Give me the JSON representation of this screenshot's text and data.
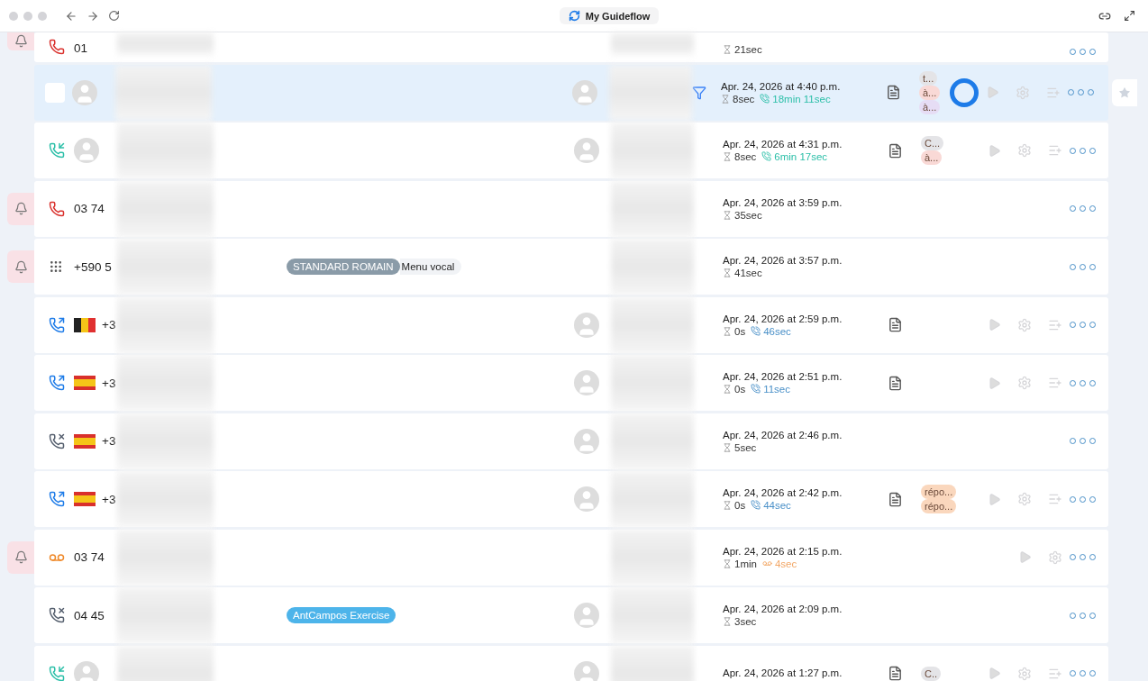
{
  "window": {
    "title": "My Guideflow"
  },
  "rows": [
    {
      "cut_top": true,
      "selected": false,
      "alert": true,
      "call": {
        "kind": "missed"
      },
      "number": "01",
      "wait": "21sec"
    },
    {
      "selected": true,
      "checked": false,
      "alert": false,
      "contact": true,
      "contact2": true,
      "filter": true,
      "date": "Apr. 24, 2026 at 4:40 p.m.",
      "wait": "8sec",
      "talk": {
        "kind": "call",
        "text": "18min 11sec",
        "color": "#2bbfa8"
      },
      "note": true,
      "tags": [
        {
          "label": "t...",
          "color": "#e4e4e7"
        },
        {
          "label": "à...",
          "color": "#f9d9d6"
        },
        {
          "label": "à...",
          "color": "#e6ddf5"
        }
      ],
      "actions": [
        {
          "kind": "play"
        },
        {
          "kind": "gear"
        },
        {
          "kind": "add"
        }
      ],
      "click_highlight": true,
      "starred": false
    },
    {
      "selected": false,
      "alert": false,
      "call": {
        "kind": "incoming"
      },
      "contact": true,
      "contact2": true,
      "date": "Apr. 24, 2026 at 4:31 p.m.",
      "wait": "8sec",
      "talk": {
        "kind": "call",
        "text": "6min 17sec",
        "color": "#2bbfa8"
      },
      "note": true,
      "tags": [
        {
          "label": "C...",
          "color": "#e4e4e7"
        },
        {
          "label": "à...",
          "color": "#f9d9d6"
        }
      ],
      "actions": [
        {
          "kind": "play"
        },
        {
          "kind": "gear"
        },
        {
          "kind": "add"
        }
      ]
    },
    {
      "selected": false,
      "alert": true,
      "call": {
        "kind": "missed"
      },
      "number": "03 74",
      "date": "Apr. 24, 2026 at 3:59 p.m.",
      "wait": "35sec"
    },
    {
      "selected": false,
      "alert": true,
      "call": {
        "kind": "keypad"
      },
      "number": "+590 5",
      "ivr": {
        "label": "STANDARD ROMAIN",
        "menu": "Menu vocal"
      },
      "date": "Apr. 24, 2026 at 3:57 p.m.",
      "wait": "41sec"
    },
    {
      "selected": false,
      "alert": false,
      "call": {
        "kind": "outgoing"
      },
      "flag": {
        "kind": "be"
      },
      "number": "+3",
      "contact2": true,
      "date": "Apr. 24, 2026 at 2:59 p.m.",
      "wait": "0s",
      "talk": {
        "kind": "call",
        "text": "46sec",
        "color": "#4a90c8"
      },
      "note": true,
      "actions": [
        {
          "kind": "play"
        },
        {
          "kind": "gear"
        },
        {
          "kind": "add"
        }
      ]
    },
    {
      "selected": false,
      "alert": false,
      "call": {
        "kind": "outgoing"
      },
      "flag": {
        "kind": "es"
      },
      "number": "+3",
      "contact2": true,
      "date": "Apr. 24, 2026 at 2:51 p.m.",
      "wait": "0s",
      "talk": {
        "kind": "call",
        "text": "11sec",
        "color": "#4a90c8"
      },
      "note": true,
      "actions": [
        {
          "kind": "play"
        },
        {
          "kind": "gear"
        },
        {
          "kind": "add"
        }
      ]
    },
    {
      "selected": false,
      "alert": false,
      "call": {
        "kind": "cancelled"
      },
      "flag": {
        "kind": "es"
      },
      "number": "+3",
      "contact2": true,
      "date": "Apr. 24, 2026 at 2:46 p.m.",
      "wait": "5sec"
    },
    {
      "selected": false,
      "alert": false,
      "call": {
        "kind": "outgoing"
      },
      "flag": {
        "kind": "es"
      },
      "number": "+3",
      "contact2": true,
      "date": "Apr. 24, 2026 at 2:42 p.m.",
      "wait": "0s",
      "talk": {
        "kind": "call",
        "text": "44sec",
        "color": "#4a90c8"
      },
      "note": true,
      "tags": [
        {
          "label": "répo...",
          "color": "#fad7bd"
        },
        {
          "label": "répo...",
          "color": "#fad7bd"
        }
      ],
      "actions": [
        {
          "kind": "play"
        },
        {
          "kind": "gear"
        },
        {
          "kind": "add"
        }
      ]
    },
    {
      "selected": false,
      "alert": true,
      "call": {
        "kind": "voicemail"
      },
      "number": "03 74",
      "date": "Apr. 24, 2026 at 2:15 p.m.",
      "wait": "1min",
      "talk": {
        "kind": "voicemail",
        "text": "4sec",
        "color": "#f2a766"
      },
      "actions": [
        {
          "kind": "play"
        },
        {
          "kind": "gear"
        }
      ]
    },
    {
      "selected": false,
      "alert": false,
      "call": {
        "kind": "cancelled"
      },
      "number": "04 45",
      "team": "AntCampos Exercise",
      "contact2": true,
      "date": "Apr. 24, 2026 at 2:09 p.m.",
      "wait": "3sec"
    },
    {
      "selected": false,
      "alert": false,
      "call": {
        "kind": "incoming"
      },
      "contact": true,
      "contact2": true,
      "date": "Apr. 24, 2026 at 1:27 p.m.",
      "note": true,
      "tags": [
        {
          "label": "C..",
          "color": "#e4e4e7"
        }
      ],
      "actions": [
        {
          "kind": "play"
        },
        {
          "kind": "gear"
        },
        {
          "kind": "add"
        }
      ]
    }
  ]
}
